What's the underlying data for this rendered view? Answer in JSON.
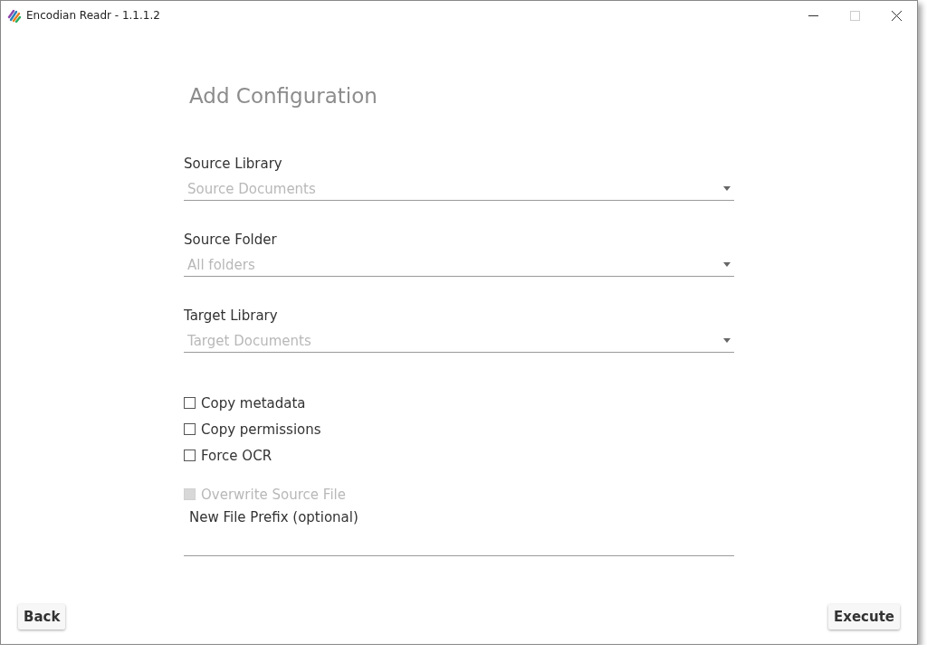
{
  "window": {
    "title": "Encodian Readr - 1.1.1.2"
  },
  "heading": "Add Configuration",
  "dropdowns": [
    {
      "label": "Source Library",
      "placeholder": "Source Documents"
    },
    {
      "label": "Source Folder",
      "placeholder": "All folders"
    },
    {
      "label": "Target Library",
      "placeholder": "Target Documents"
    }
  ],
  "checkboxes": [
    {
      "label": "Copy metadata",
      "checked": false,
      "disabled": false
    },
    {
      "label": "Copy permissions",
      "checked": false,
      "disabled": false
    },
    {
      "label": "Force OCR",
      "checked": false,
      "disabled": false
    },
    {
      "label": "Overwrite Source File",
      "checked": false,
      "disabled": true
    }
  ],
  "prefix_field": {
    "label": "New File Prefix (optional)"
  },
  "buttons": [
    {
      "label": "Back"
    },
    {
      "label": "Execute"
    }
  ]
}
